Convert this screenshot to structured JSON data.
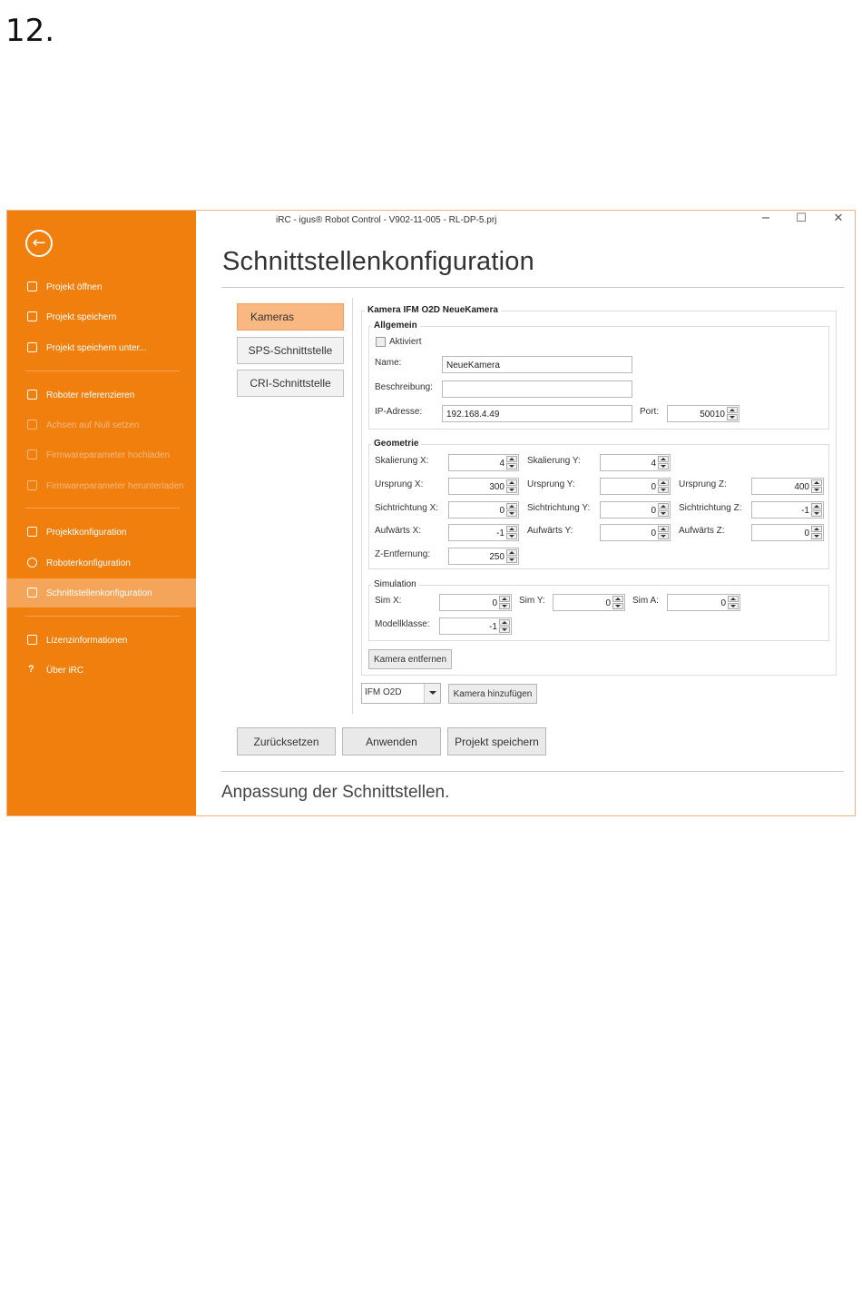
{
  "page_number": "12.",
  "window": {
    "title": "iRC - igus® Robot Control - V902-11-005 - RL-DP-5.prj",
    "controls": {
      "minimize": "−",
      "maximize": "☐",
      "close": "✕"
    }
  },
  "sidebar": {
    "back_icon": "←",
    "items": [
      {
        "label": "Projekt öffnen",
        "icon": "folder-open-icon",
        "state": "normal"
      },
      {
        "label": "Projekt speichern",
        "icon": "save-icon",
        "state": "normal"
      },
      {
        "label": "Projekt speichern unter...",
        "icon": "save-as-icon",
        "state": "normal"
      },
      {
        "label": "Roboter referenzieren",
        "icon": "reference-icon",
        "state": "normal"
      },
      {
        "label": "Achsen auf Null setzen",
        "icon": "zero-axes-icon",
        "state": "disabled"
      },
      {
        "label": "Firmwareparameter hochladen",
        "icon": "upload-icon",
        "state": "disabled"
      },
      {
        "label": "Firmwareparameter herunterladen",
        "icon": "download-icon",
        "state": "disabled"
      },
      {
        "label": "Projektkonfiguration",
        "icon": "project-config-icon",
        "state": "normal"
      },
      {
        "label": "Roboterkonfiguration",
        "icon": "gear-icon",
        "state": "normal"
      },
      {
        "label": "Schnittstellenkonfiguration",
        "icon": "interface-icon",
        "state": "active"
      },
      {
        "label": "Lizenzinformationen",
        "icon": "license-icon",
        "state": "normal"
      },
      {
        "label": "Über iRC",
        "icon": "help-icon",
        "state": "normal"
      }
    ]
  },
  "main": {
    "title": "Schnittstellenkonfiguration",
    "tabs": [
      {
        "label": "Kameras",
        "active": true
      },
      {
        "label": "SPS-Schnittstelle",
        "active": false
      },
      {
        "label": "CRI-Schnittstelle",
        "active": false
      }
    ],
    "camera": {
      "title": "Kamera IFM O2D NeueKamera",
      "allgemein": {
        "title": "Allgemein",
        "aktiviert_label": "Aktiviert",
        "aktiviert": false,
        "name_label": "Name:",
        "name_value": "NeueKamera",
        "beschreibung_label": "Beschreibung:",
        "beschreibung_value": "",
        "ip_label": "IP-Adresse:",
        "ip_value": "192.168.4.49",
        "port_label": "Port:",
        "port_value": "50010"
      },
      "geometrie": {
        "title": "Geometrie",
        "skalierung_x_label": "Skalierung X:",
        "skalierung_x": "4",
        "skalierung_y_label": "Skalierung Y:",
        "skalierung_y": "4",
        "ursprung_x_label": "Ursprung X:",
        "ursprung_x": "300",
        "ursprung_y_label": "Ursprung Y:",
        "ursprung_y": "0",
        "ursprung_z_label": "Ursprung Z:",
        "ursprung_z": "400",
        "sicht_x_label": "Sichtrichtung X:",
        "sicht_x": "0",
        "sicht_y_label": "Sichtrichtung Y:",
        "sicht_y": "0",
        "sicht_z_label": "Sichtrichtung Z:",
        "sicht_z": "-1",
        "aufwaerts_x_label": "Aufwärts X:",
        "aufwaerts_x": "-1",
        "aufwaerts_y_label": "Aufwärts Y:",
        "aufwaerts_y": "0",
        "aufwaerts_z_label": "Aufwärts Z:",
        "aufwaerts_z": "0",
        "z_entfernung_label": "Z-Entfernung:",
        "z_entfernung": "250"
      },
      "simulation": {
        "title": "Simulation",
        "sim_x_label": "Sim X:",
        "sim_x": "0",
        "sim_y_label": "Sim Y:",
        "sim_y": "0",
        "sim_a_label": "Sim A:",
        "sim_a": "0",
        "modellklasse_label": "Modellklasse:",
        "modellklasse": "-1"
      },
      "remove_label": "Kamera entfernen"
    },
    "camera_type_select": "IFM O2D",
    "add_camera_label": "Kamera hinzufügen",
    "buttons": {
      "reset": "Zurücksetzen",
      "apply": "Anwenden",
      "save_project": "Projekt speichern"
    },
    "status": "Anpassung der Schnittstellen."
  },
  "colors": {
    "sidebar": "#f07f0d",
    "sidebar_active": "#f5a55a",
    "tab_active": "#f9b781"
  }
}
